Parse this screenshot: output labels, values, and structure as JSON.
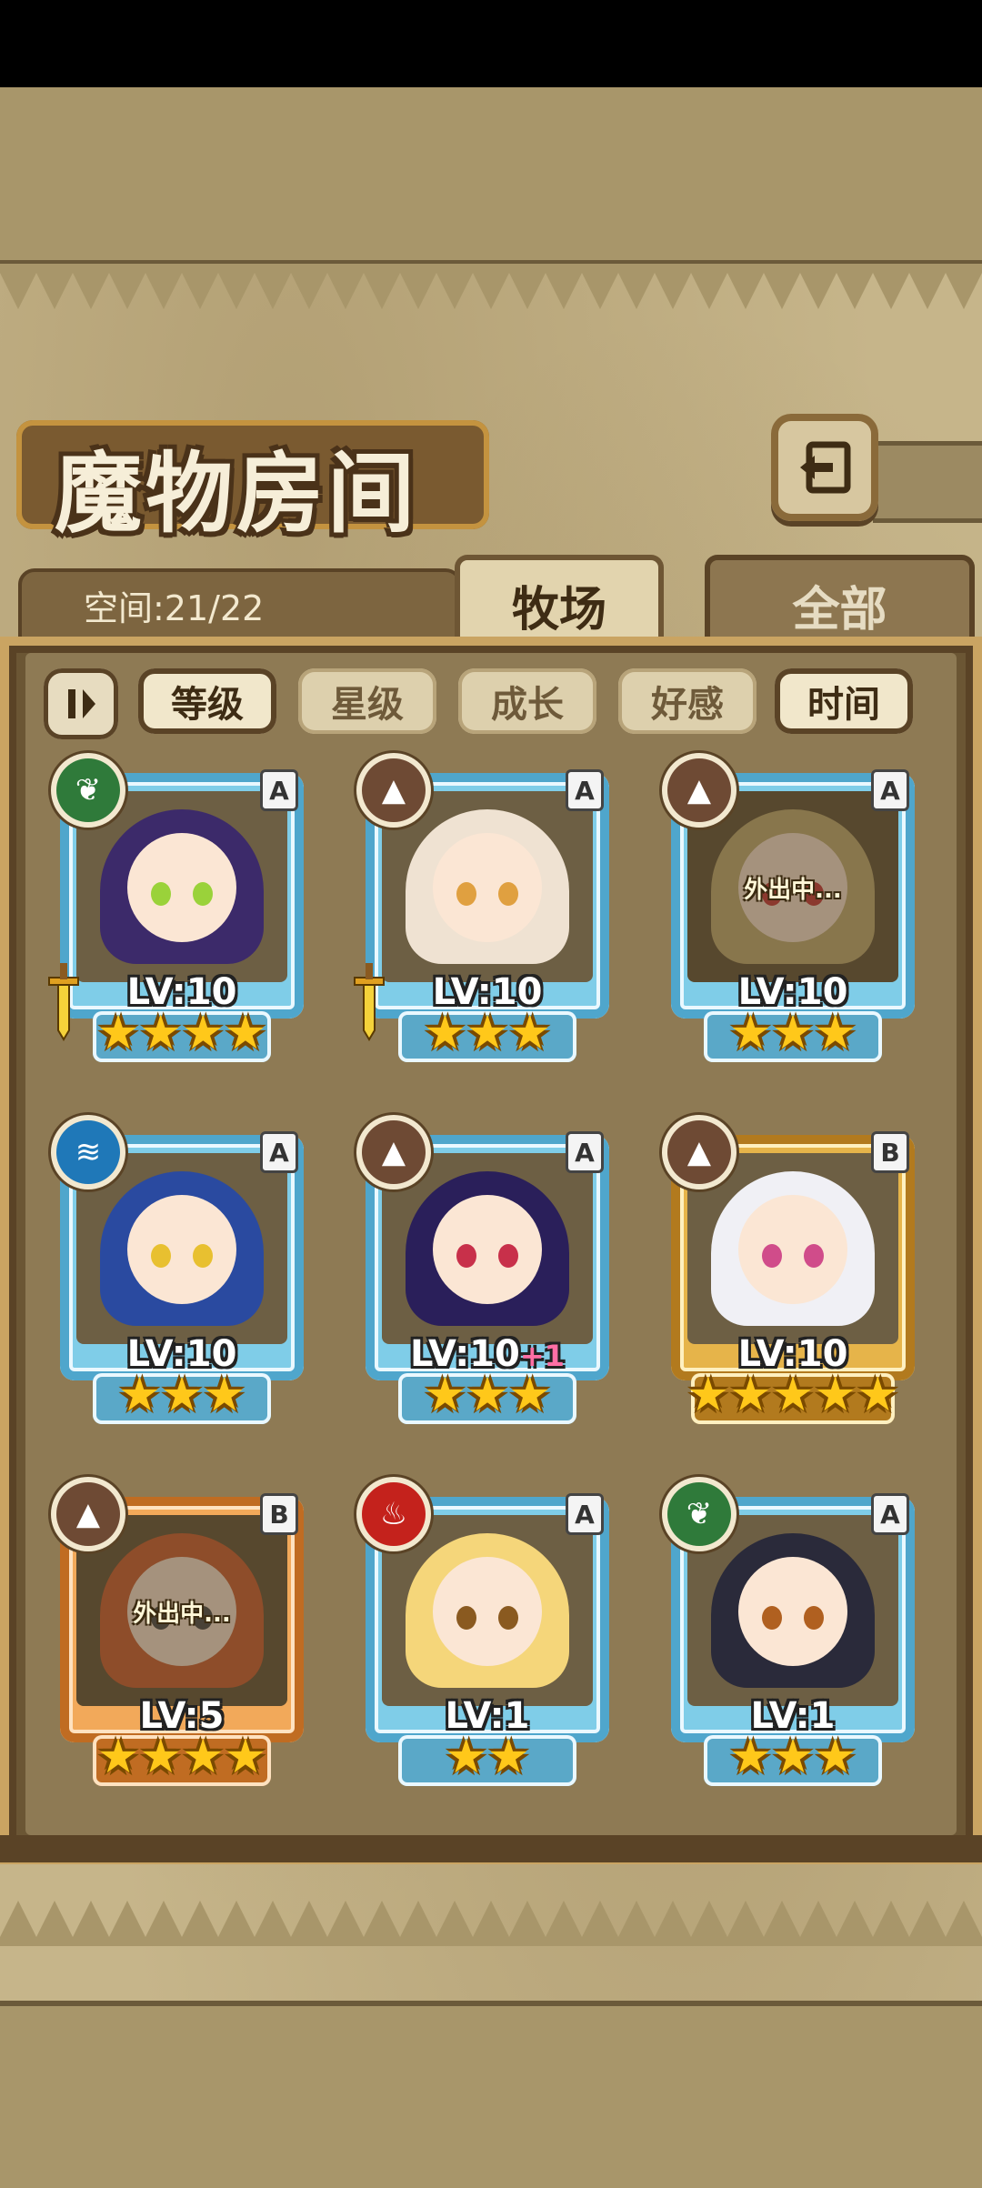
{
  "header": {
    "title": "魔物房间",
    "back_icon": "return-arrow-icon"
  },
  "tabs": [
    {
      "label": "牧场",
      "active": true
    },
    {
      "label": "全部",
      "active": false
    }
  ],
  "space": {
    "label": "空间:21/22"
  },
  "filters": {
    "toggle_icon": "sort-order-icon",
    "items": [
      {
        "label": "等级",
        "active": true
      },
      {
        "label": "星级",
        "active": false
      },
      {
        "label": "成长",
        "active": false
      },
      {
        "label": "好感",
        "active": false
      },
      {
        "label": "时间",
        "active": false
      }
    ]
  },
  "monsters": [
    {
      "element": "leaf",
      "rank": "A",
      "level": "LV:10",
      "bonus": "",
      "stars": 4,
      "status": "",
      "equipped": true,
      "frame": "blue"
    },
    {
      "element": "earth",
      "rank": "A",
      "level": "LV:10",
      "bonus": "",
      "stars": 3,
      "status": "",
      "equipped": true,
      "frame": "blue"
    },
    {
      "element": "earth",
      "rank": "A",
      "level": "LV:10",
      "bonus": "",
      "stars": 3,
      "status": "外出中...",
      "equipped": false,
      "frame": "blue"
    },
    {
      "element": "water",
      "rank": "A",
      "level": "LV:10",
      "bonus": "",
      "stars": 3,
      "status": "",
      "equipped": false,
      "frame": "blue"
    },
    {
      "element": "earth",
      "rank": "A",
      "level": "LV:10",
      "bonus": "+1",
      "stars": 3,
      "status": "",
      "equipped": false,
      "frame": "blue"
    },
    {
      "element": "earth",
      "rank": "B",
      "level": "LV:10",
      "bonus": "",
      "stars": 5,
      "status": "",
      "equipped": false,
      "frame": "gold"
    },
    {
      "element": "earth",
      "rank": "B",
      "level": "LV:5",
      "bonus": "",
      "stars": 4,
      "status": "外出中...",
      "equipped": false,
      "frame": "orange"
    },
    {
      "element": "fire",
      "rank": "A",
      "level": "LV:1",
      "bonus": "",
      "stars": 2,
      "status": "",
      "equipped": false,
      "frame": "blue"
    },
    {
      "element": "leaf",
      "rank": "A",
      "level": "LV:1",
      "bonus": "",
      "stars": 3,
      "status": "",
      "equipped": false,
      "frame": "blue"
    }
  ],
  "colors": {
    "leaf": "#2f7a3a",
    "earth": "#6e4a34",
    "water": "#1f78b8",
    "fire": "#c4221c"
  }
}
